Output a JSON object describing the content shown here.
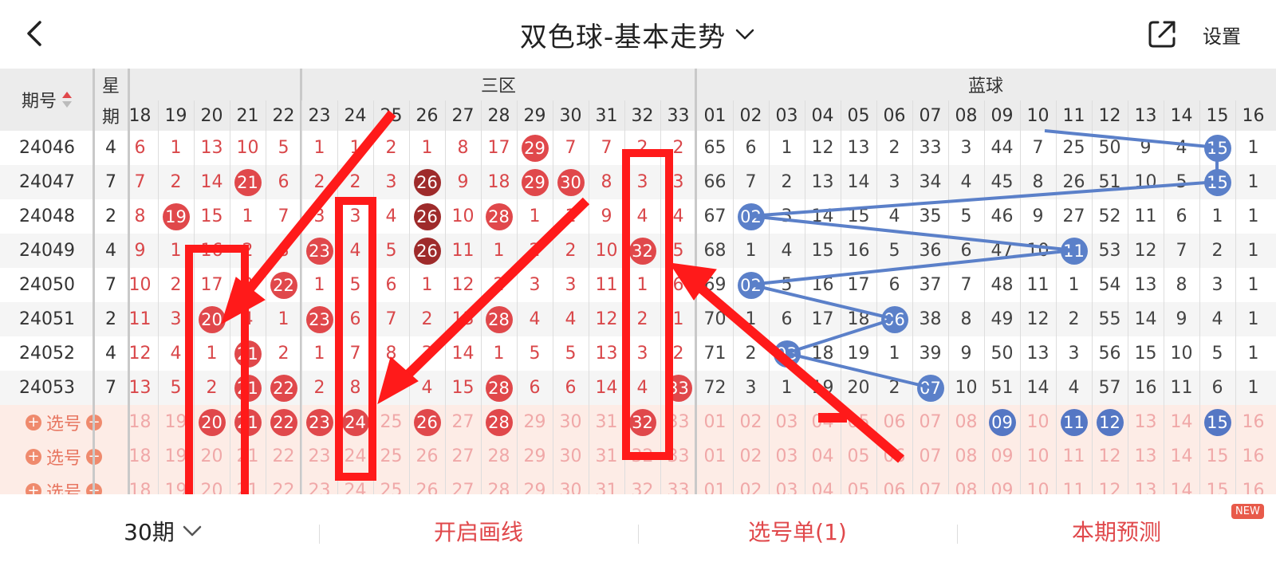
{
  "header": {
    "title": "双色球-基本走势",
    "settings_label": "设置"
  },
  "table_header": {
    "issue_label": "期号",
    "week_label_top": "星",
    "week_label_bottom": "期",
    "zone3_label": "三区",
    "blue_label": "蓝球",
    "red_columns": [
      "18",
      "19",
      "20",
      "21",
      "22",
      "23",
      "24",
      "25",
      "26",
      "27",
      "28",
      "29",
      "30",
      "31",
      "32",
      "33"
    ],
    "blue_columns": [
      "01",
      "02",
      "03",
      "04",
      "05",
      "06",
      "07",
      "08",
      "09",
      "10",
      "11",
      "12",
      "13",
      "14",
      "15",
      "16"
    ]
  },
  "rows": [
    {
      "issue": "24046",
      "week": "4",
      "red": [
        [
          "6",
          "n"
        ],
        [
          "1",
          "n"
        ],
        [
          "13",
          "n"
        ],
        [
          "10",
          "n"
        ],
        [
          "5",
          "n"
        ],
        [
          "1",
          "n"
        ],
        [
          "1",
          "n"
        ],
        [
          "2",
          "n"
        ],
        [
          "1",
          "n"
        ],
        [
          "8",
          "n"
        ],
        [
          "17",
          "n"
        ],
        [
          "29",
          "b"
        ],
        [
          "7",
          "n"
        ],
        [
          "7",
          "n"
        ],
        [
          "2",
          "n"
        ],
        [
          "2",
          "n"
        ]
      ],
      "blue": [
        [
          "65",
          "n"
        ],
        [
          "6",
          "n"
        ],
        [
          "1",
          "n"
        ],
        [
          "12",
          "n"
        ],
        [
          "13",
          "n"
        ],
        [
          "2",
          "n"
        ],
        [
          "33",
          "n"
        ],
        [
          "3",
          "n"
        ],
        [
          "44",
          "n"
        ],
        [
          "7",
          "n"
        ],
        [
          "25",
          "n"
        ],
        [
          "50",
          "n"
        ],
        [
          "9",
          "n"
        ],
        [
          "4",
          "n"
        ],
        [
          "15",
          "b"
        ],
        [
          "1",
          "n"
        ]
      ]
    },
    {
      "issue": "24047",
      "week": "7",
      "red": [
        [
          "7",
          "n"
        ],
        [
          "2",
          "n"
        ],
        [
          "14",
          "n"
        ],
        [
          "21",
          "b"
        ],
        [
          "6",
          "n"
        ],
        [
          "2",
          "n"
        ],
        [
          "2",
          "n"
        ],
        [
          "3",
          "n"
        ],
        [
          "26",
          "d"
        ],
        [
          "9",
          "n"
        ],
        [
          "18",
          "n"
        ],
        [
          "29",
          "b"
        ],
        [
          "30",
          "b"
        ],
        [
          "8",
          "n"
        ],
        [
          "3",
          "n"
        ],
        [
          "3",
          "n"
        ]
      ],
      "blue": [
        [
          "66",
          "n"
        ],
        [
          "7",
          "n"
        ],
        [
          "2",
          "n"
        ],
        [
          "13",
          "n"
        ],
        [
          "14",
          "n"
        ],
        [
          "3",
          "n"
        ],
        [
          "34",
          "n"
        ],
        [
          "4",
          "n"
        ],
        [
          "45",
          "n"
        ],
        [
          "8",
          "n"
        ],
        [
          "26",
          "n"
        ],
        [
          "51",
          "n"
        ],
        [
          "10",
          "n"
        ],
        [
          "5",
          "n"
        ],
        [
          "15",
          "b"
        ],
        [
          "1",
          "n"
        ]
      ]
    },
    {
      "issue": "24048",
      "week": "2",
      "red": [
        [
          "8",
          "n"
        ],
        [
          "19",
          "b"
        ],
        [
          "15",
          "n"
        ],
        [
          "1",
          "n"
        ],
        [
          "7",
          "n"
        ],
        [
          "3",
          "n"
        ],
        [
          "3",
          "n"
        ],
        [
          "4",
          "n"
        ],
        [
          "26",
          "d"
        ],
        [
          "10",
          "n"
        ],
        [
          "28",
          "b"
        ],
        [
          "1",
          "n"
        ],
        [
          "1",
          "n"
        ],
        [
          "9",
          "n"
        ],
        [
          "4",
          "n"
        ],
        [
          "4",
          "n"
        ]
      ],
      "blue": [
        [
          "67",
          "n"
        ],
        [
          "02",
          "b"
        ],
        [
          "3",
          "n"
        ],
        [
          "14",
          "n"
        ],
        [
          "15",
          "n"
        ],
        [
          "4",
          "n"
        ],
        [
          "35",
          "n"
        ],
        [
          "5",
          "n"
        ],
        [
          "46",
          "n"
        ],
        [
          "9",
          "n"
        ],
        [
          "27",
          "n"
        ],
        [
          "52",
          "n"
        ],
        [
          "11",
          "n"
        ],
        [
          "6",
          "n"
        ],
        [
          "1",
          "n"
        ],
        [
          "1",
          "n"
        ]
      ]
    },
    {
      "issue": "24049",
      "week": "4",
      "red": [
        [
          "9",
          "n"
        ],
        [
          "1",
          "n"
        ],
        [
          "16",
          "n"
        ],
        [
          "2",
          "n"
        ],
        [
          "8",
          "n"
        ],
        [
          "23",
          "b"
        ],
        [
          "4",
          "n"
        ],
        [
          "5",
          "n"
        ],
        [
          "26",
          "d"
        ],
        [
          "11",
          "n"
        ],
        [
          "1",
          "n"
        ],
        [
          "2",
          "n"
        ],
        [
          "2",
          "n"
        ],
        [
          "10",
          "n"
        ],
        [
          "32",
          "b"
        ],
        [
          "5",
          "n"
        ]
      ],
      "blue": [
        [
          "68",
          "n"
        ],
        [
          "1",
          "n"
        ],
        [
          "4",
          "n"
        ],
        [
          "15",
          "n"
        ],
        [
          "16",
          "n"
        ],
        [
          "5",
          "n"
        ],
        [
          "36",
          "n"
        ],
        [
          "6",
          "n"
        ],
        [
          "47",
          "n"
        ],
        [
          "10",
          "n"
        ],
        [
          "11",
          "b"
        ],
        [
          "53",
          "n"
        ],
        [
          "12",
          "n"
        ],
        [
          "7",
          "n"
        ],
        [
          "2",
          "n"
        ],
        [
          "1",
          "n"
        ]
      ]
    },
    {
      "issue": "24050",
      "week": "7",
      "red": [
        [
          "10",
          "n"
        ],
        [
          "2",
          "n"
        ],
        [
          "17",
          "n"
        ],
        [
          "3",
          "n"
        ],
        [
          "22",
          "b"
        ],
        [
          "1",
          "n"
        ],
        [
          "5",
          "n"
        ],
        [
          "6",
          "n"
        ],
        [
          "1",
          "n"
        ],
        [
          "12",
          "n"
        ],
        [
          "2",
          "n"
        ],
        [
          "3",
          "n"
        ],
        [
          "3",
          "n"
        ],
        [
          "11",
          "n"
        ],
        [
          "1",
          "n"
        ],
        [
          "6",
          "n"
        ]
      ],
      "blue": [
        [
          "69",
          "n"
        ],
        [
          "02",
          "b"
        ],
        [
          "5",
          "n"
        ],
        [
          "16",
          "n"
        ],
        [
          "17",
          "n"
        ],
        [
          "6",
          "n"
        ],
        [
          "37",
          "n"
        ],
        [
          "7",
          "n"
        ],
        [
          "48",
          "n"
        ],
        [
          "11",
          "n"
        ],
        [
          "1",
          "n"
        ],
        [
          "54",
          "n"
        ],
        [
          "13",
          "n"
        ],
        [
          "8",
          "n"
        ],
        [
          "3",
          "n"
        ],
        [
          "1",
          "n"
        ]
      ]
    },
    {
      "issue": "24051",
      "week": "2",
      "red": [
        [
          "11",
          "n"
        ],
        [
          "3",
          "n"
        ],
        [
          "20",
          "b"
        ],
        [
          "4",
          "n"
        ],
        [
          "1",
          "n"
        ],
        [
          "23",
          "b"
        ],
        [
          "6",
          "n"
        ],
        [
          "7",
          "n"
        ],
        [
          "2",
          "n"
        ],
        [
          "13",
          "n"
        ],
        [
          "28",
          "b"
        ],
        [
          "4",
          "n"
        ],
        [
          "4",
          "n"
        ],
        [
          "12",
          "n"
        ],
        [
          "2",
          "n"
        ],
        [
          "1",
          "n"
        ]
      ],
      "blue": [
        [
          "70",
          "n"
        ],
        [
          "1",
          "n"
        ],
        [
          "6",
          "n"
        ],
        [
          "17",
          "n"
        ],
        [
          "18",
          "n"
        ],
        [
          "06",
          "b"
        ],
        [
          "38",
          "n"
        ],
        [
          "8",
          "n"
        ],
        [
          "49",
          "n"
        ],
        [
          "12",
          "n"
        ],
        [
          "2",
          "n"
        ],
        [
          "55",
          "n"
        ],
        [
          "14",
          "n"
        ],
        [
          "9",
          "n"
        ],
        [
          "4",
          "n"
        ],
        [
          "1",
          "n"
        ]
      ]
    },
    {
      "issue": "24052",
      "week": "4",
      "red": [
        [
          "12",
          "n"
        ],
        [
          "4",
          "n"
        ],
        [
          "1",
          "n"
        ],
        [
          "21",
          "b"
        ],
        [
          "2",
          "n"
        ],
        [
          "1",
          "n"
        ],
        [
          "7",
          "n"
        ],
        [
          "8",
          "n"
        ],
        [
          "3",
          "n"
        ],
        [
          "14",
          "n"
        ],
        [
          "1",
          "n"
        ],
        [
          "5",
          "n"
        ],
        [
          "5",
          "n"
        ],
        [
          "13",
          "n"
        ],
        [
          "3",
          "n"
        ],
        [
          "2",
          "n"
        ]
      ],
      "blue": [
        [
          "71",
          "n"
        ],
        [
          "2",
          "n"
        ],
        [
          "03",
          "b"
        ],
        [
          "18",
          "n"
        ],
        [
          "19",
          "n"
        ],
        [
          "1",
          "n"
        ],
        [
          "39",
          "n"
        ],
        [
          "9",
          "n"
        ],
        [
          "50",
          "n"
        ],
        [
          "13",
          "n"
        ],
        [
          "3",
          "n"
        ],
        [
          "56",
          "n"
        ],
        [
          "15",
          "n"
        ],
        [
          "10",
          "n"
        ],
        [
          "5",
          "n"
        ],
        [
          "1",
          "n"
        ]
      ]
    },
    {
      "issue": "24053",
      "week": "7",
      "red": [
        [
          "13",
          "n"
        ],
        [
          "5",
          "n"
        ],
        [
          "2",
          "n"
        ],
        [
          "21",
          "b"
        ],
        [
          "22",
          "b"
        ],
        [
          "2",
          "n"
        ],
        [
          "8",
          "n"
        ],
        [
          "9",
          "n"
        ],
        [
          "4",
          "n"
        ],
        [
          "15",
          "n"
        ],
        [
          "28",
          "b"
        ],
        [
          "6",
          "n"
        ],
        [
          "6",
          "n"
        ],
        [
          "14",
          "n"
        ],
        [
          "4",
          "n"
        ],
        [
          "33",
          "b"
        ]
      ],
      "blue": [
        [
          "72",
          "n"
        ],
        [
          "3",
          "n"
        ],
        [
          "1",
          "n"
        ],
        [
          "19",
          "n"
        ],
        [
          "20",
          "n"
        ],
        [
          "2",
          "n"
        ],
        [
          "07",
          "b"
        ],
        [
          "10",
          "n"
        ],
        [
          "51",
          "n"
        ],
        [
          "14",
          "n"
        ],
        [
          "4",
          "n"
        ],
        [
          "57",
          "n"
        ],
        [
          "16",
          "n"
        ],
        [
          "11",
          "n"
        ],
        [
          "6",
          "n"
        ],
        [
          "1",
          "n"
        ]
      ]
    }
  ],
  "pick_rows": [
    {
      "label": "选号",
      "plus": "+",
      "minus": "−",
      "red_selected": [
        "20",
        "21",
        "22",
        "23",
        "24",
        "26",
        "28",
        "32"
      ],
      "blue_selected": [
        "09",
        "11",
        "12",
        "15"
      ]
    },
    {
      "label": "选号",
      "plus": "+",
      "minus": "−",
      "red_selected": [],
      "blue_selected": []
    },
    {
      "label": "选号",
      "plus": "+",
      "minus": "−",
      "red_selected": [],
      "blue_selected": []
    }
  ],
  "footer": {
    "period_label": "30期",
    "draw_line_label": "开启画线",
    "pick_list_label": "选号单(1)",
    "predict_label": "本期预测",
    "new_badge": "NEW"
  },
  "colors": {
    "red_ball": "#e0484b",
    "dark_red_ball": "#9e2b2b",
    "blue_ball": "#5b80c9",
    "annotation_red": "#ff0000",
    "link_red": "#e0484b"
  }
}
